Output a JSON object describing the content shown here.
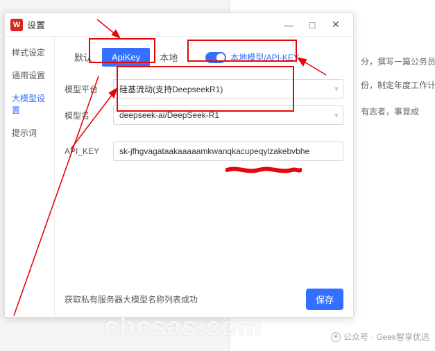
{
  "window": {
    "title": "设置",
    "logo_letter": "W",
    "minimize_glyph": "—",
    "maximize_glyph": "□",
    "close_glyph": "✕"
  },
  "sidebar": {
    "items": [
      {
        "label": "样式设定"
      },
      {
        "label": "通用设置"
      },
      {
        "label": "大模型设置"
      },
      {
        "label": "提示词"
      }
    ],
    "active_index": 2
  },
  "tabs": {
    "items": [
      {
        "label": "默认"
      },
      {
        "label": "ApiKey"
      },
      {
        "label": "本地"
      }
    ],
    "active_index": 1
  },
  "toggle": {
    "on": true,
    "label": "本地模型/API-KEY"
  },
  "form": {
    "platform_label": "模型平台",
    "platform_value": "硅基流动(支持DeepseekR1)",
    "model_label": "模型名",
    "model_value": "deepseek-ai/DeepSeek-R1",
    "apikey_label": "API_KEY",
    "apikey_value": "sk-jfhgvagataakaaaaamkwanqkacupeqylzakebvbhe"
  },
  "footer": {
    "status": "获取私有服务器大模型名称列表成功",
    "save_label": "保存"
  },
  "background": {
    "line1": "分，撰写一篇公务员转正",
    "line2": "份，制定年度工作计划",
    "line3": "有志者，事竟成"
  },
  "credit": {
    "prefix": "公众号 · ",
    "name": "Geek智享优选"
  },
  "watermark": "chcsas.com"
}
